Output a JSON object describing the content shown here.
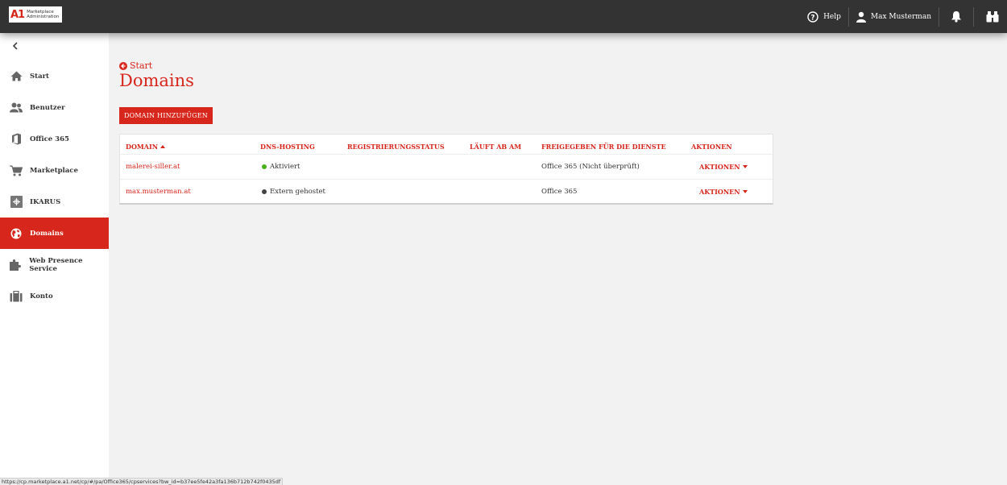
{
  "app": {
    "logo_mark": "A1",
    "logo_line1": "Marketplace",
    "logo_line2": "Administration"
  },
  "topbar": {
    "help_label": "Help",
    "user_name": "Max Musterman"
  },
  "sidebar": {
    "items": [
      {
        "label": "Start",
        "icon": "home-icon",
        "active": false
      },
      {
        "label": "Benutzer",
        "icon": "users-icon",
        "active": false
      },
      {
        "label": "Office 365",
        "icon": "office-icon",
        "active": false
      },
      {
        "label": "Marketplace",
        "icon": "cart-icon",
        "active": false
      },
      {
        "label": "IKARUS",
        "icon": "ikarus-icon",
        "active": false
      },
      {
        "label": "Domains",
        "icon": "globe-icon",
        "active": true
      },
      {
        "label": "Web Presence Service",
        "icon": "puzzle-icon",
        "active": false
      },
      {
        "label": "Konto",
        "icon": "briefcase-icon",
        "active": false
      }
    ]
  },
  "main": {
    "back_label": "Start",
    "title": "Domains",
    "add_button": "DOMAIN HINZUFÜGEN"
  },
  "table": {
    "columns": [
      "DOMAIN",
      "DNS-HOSTING",
      "REGISTRIERUNGSSTATUS",
      "LÄUFT AB AM",
      "FREIGEGEBEN FÜR DIE DIENSTE",
      "AKTIONEN"
    ],
    "rows": [
      {
        "domain": "malerei-siller.at",
        "dns": "Aktiviert",
        "dns_color": "#4caf1a",
        "status": "",
        "expires": "",
        "services": "Office 365 (Nicht überprüft)",
        "action": "AKTIONEN"
      },
      {
        "domain": "max.musterman.at",
        "dns": "Extern gehostet",
        "dns_color": "#444444",
        "status": "",
        "expires": "",
        "services": "Office 365",
        "action": "AKTIONEN"
      }
    ]
  },
  "statusbar": {
    "url": "https://cp.marketplace.a1.net/cp/#/pa/Office365/cpservices?bw_id=b37ee5fe42a3fa136b712b742f0435df"
  },
  "colors": {
    "accent": "#d7261b",
    "topbar": "#333333"
  }
}
